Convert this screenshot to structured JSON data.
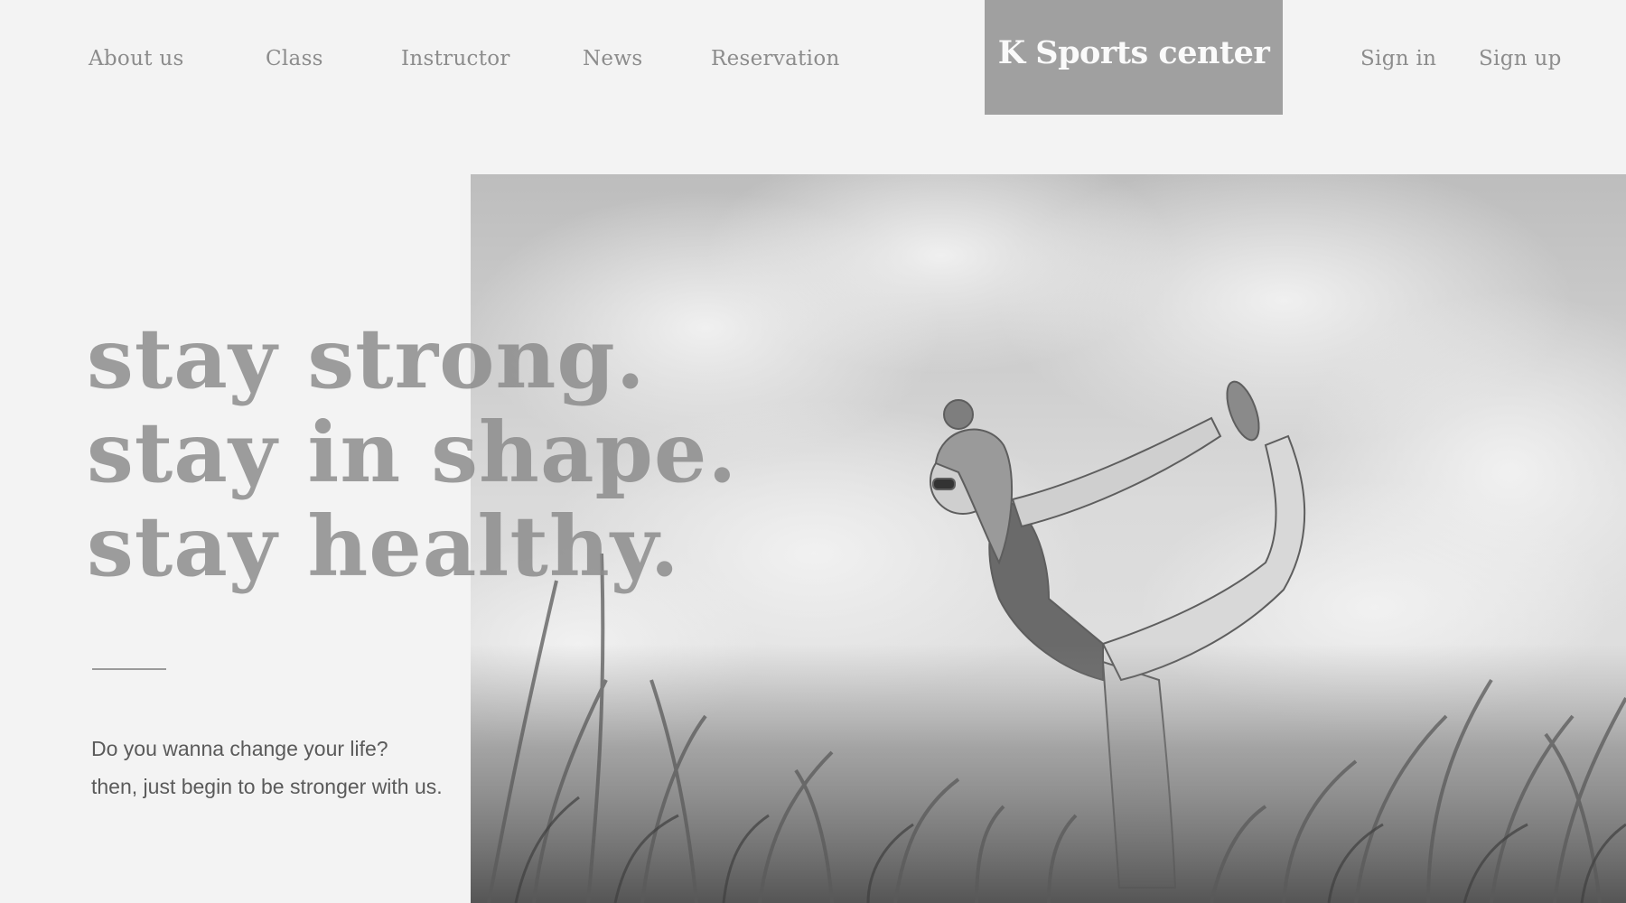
{
  "nav": {
    "items": [
      {
        "label": "About us"
      },
      {
        "label": "Class"
      },
      {
        "label": "Instructor"
      },
      {
        "label": "News"
      },
      {
        "label": "Reservation"
      }
    ],
    "brand": "K Sports center",
    "sign_in": "Sign in",
    "sign_up": "Sign up"
  },
  "hero": {
    "headline": [
      "stay strong.",
      "stay in shape.",
      "stay healthy."
    ],
    "tagline": [
      "Do you wanna change your life?",
      "then, just begin to be stronger with us."
    ]
  },
  "colors": {
    "background": "#f3f3f3",
    "brand_block": "#a0a0a0",
    "nav_text": "#8c8c8c",
    "headline": "#8c8c8c",
    "body_text": "#5a5a5a"
  }
}
